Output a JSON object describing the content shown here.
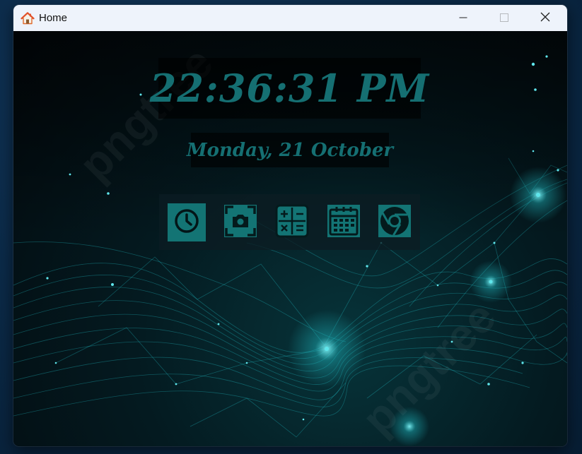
{
  "window": {
    "title": "Home",
    "icon": "home-icon",
    "controls": [
      "minimize-icon",
      "maximize-icon",
      "close-icon"
    ]
  },
  "clock": {
    "time": "22:36:31 PM",
    "date": "Monday, 21 October"
  },
  "dock": {
    "items": [
      {
        "name": "clock-app",
        "icon": "clock-icon",
        "active": true
      },
      {
        "name": "camera-app",
        "icon": "camera-icon",
        "active": false
      },
      {
        "name": "calculator-app",
        "icon": "calculator-icon",
        "active": false
      },
      {
        "name": "calendar-app",
        "icon": "calendar-icon",
        "active": false
      },
      {
        "name": "chrome-app",
        "icon": "chrome-icon",
        "active": false
      }
    ]
  },
  "watermark": "pngtree",
  "colors": {
    "accent": "#156f72",
    "active_tile": "#137474",
    "title_bar": "#eef3fb",
    "network_lines": "#1fb5bd"
  }
}
